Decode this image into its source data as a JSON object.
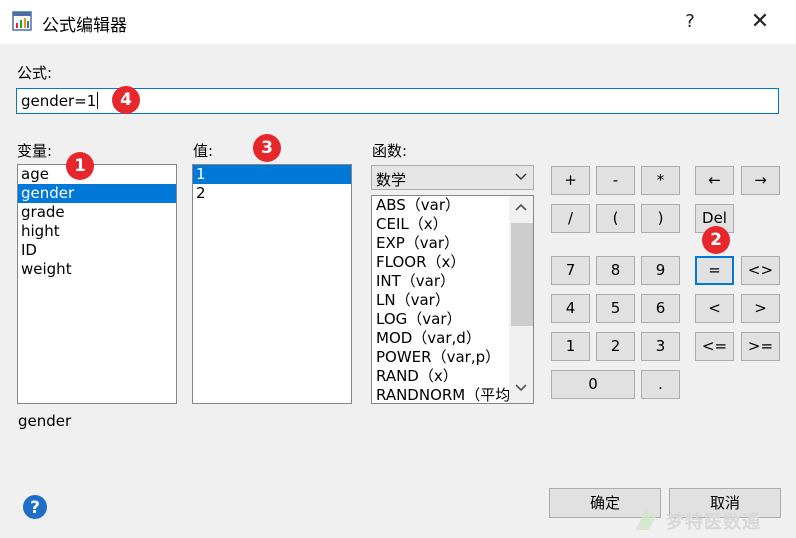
{
  "window": {
    "title": "公式编辑器",
    "help_label": "?",
    "close_label": "✕"
  },
  "formula": {
    "label": "公式:",
    "value": "gender=1"
  },
  "variables": {
    "label": "变量:",
    "items": [
      "age",
      "gender",
      "grade",
      "hight",
      "ID",
      "weight"
    ],
    "selected": "gender"
  },
  "values": {
    "label": "值:",
    "items": [
      "1",
      "2"
    ],
    "selected": "1"
  },
  "functions": {
    "label": "函数:",
    "category": "数学",
    "items": [
      "ABS（var）",
      "CEIL（x）",
      "EXP（var）",
      "FLOOR（x）",
      "INT（var）",
      "LN（var）",
      "LOG（var）",
      "MOD（var,d）",
      "POWER（var,p）",
      "RAND（x）",
      "RANDNORM（平均"
    ]
  },
  "keypad": {
    "plus": "+",
    "minus": "-",
    "times": "*",
    "divide": "/",
    "lparen": "(",
    "rparen": ")",
    "seven": "7",
    "eight": "8",
    "nine": "9",
    "four": "4",
    "five": "5",
    "six": "6",
    "one": "1",
    "two": "2",
    "three": "3",
    "zero": "0",
    "dot": ".",
    "left_arrow": "←",
    "right_arrow": "→",
    "del": "Del",
    "eq": "=",
    "neq": "<>",
    "lt": "<",
    "gt": ">",
    "le": "<=",
    "ge": ">="
  },
  "badges": {
    "one": "1",
    "two": "2",
    "three": "3",
    "four": "4"
  },
  "status": {
    "selected_variable": "gender"
  },
  "dialog": {
    "ok_label": "确定",
    "cancel_label": "取消"
  },
  "watermark": {
    "text": "梦特医数通"
  },
  "colors": {
    "accent": "#0078d7",
    "badge": "#e8272c"
  }
}
